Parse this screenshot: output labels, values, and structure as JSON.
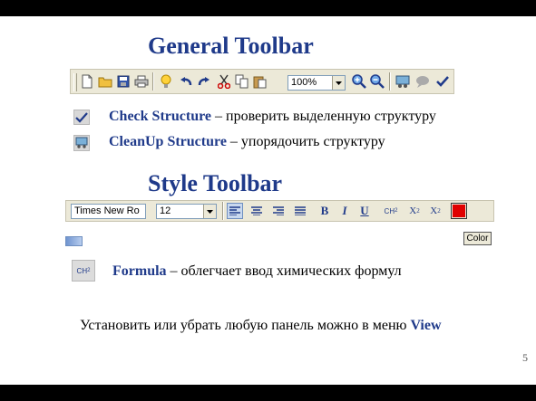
{
  "headings": {
    "general": "General Toolbar",
    "style": "Style Toolbar"
  },
  "general_toolbar": {
    "zoom_value": "100%",
    "icons": [
      "new-file-icon",
      "open-folder-icon",
      "save-icon",
      "print-icon",
      "hint-icon",
      "undo-icon",
      "redo-icon",
      "cut-icon",
      "copy-icon",
      "paste-icon",
      "zoom-in-icon",
      "zoom-out-icon",
      "cleanup-icon",
      "bubble-icon",
      "check-icon"
    ]
  },
  "style_toolbar": {
    "font_value": "Times New Ro",
    "size_value": "12",
    "bold": "B",
    "italic": "I",
    "underline": "U",
    "formula": "CH",
    "formula_sub": "2",
    "subscript": "X",
    "subscript_sub": "2",
    "superscript": "X",
    "superscript_sup": "2",
    "color_swatch": "#e00000",
    "color_label": "Color"
  },
  "descriptions": {
    "check_name": "Check Structure",
    "check_text": " – проверить выделенную структуру",
    "cleanup_name": "CleanUp Structure",
    "cleanup_text": " – упорядочить структуру",
    "formula_name": "Formula",
    "formula_text": " – облегчает ввод химических формул",
    "formula_icon": "CH",
    "formula_icon_sub": "2"
  },
  "footer": {
    "note_text": "Установить или убрать любую панель можно в меню ",
    "note_menu": "View",
    "page_number": "5"
  },
  "colors": {
    "heading": "#1f3a8a",
    "toolbar_bg": "#ece9d8",
    "swatch": "#e00000"
  }
}
